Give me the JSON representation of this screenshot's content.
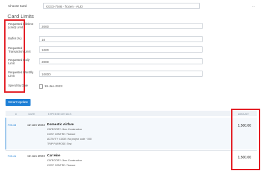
{
  "choose_card": {
    "label": "Choose Card",
    "value": "XXXX-7046 · frozen · AUD",
    "more": "..."
  },
  "card_limits": {
    "title": "Card Limits",
    "fields": [
      {
        "label": "Requested Lifetime (card) Limit",
        "value": "2000"
      },
      {
        "label": "Buffer (%)",
        "value": "10"
      },
      {
        "label": "Requested Transaction Limit",
        "value": "1000"
      },
      {
        "label": "Requested Daily Limit",
        "value": "2000"
      },
      {
        "label": "Requested Monthly Limit",
        "value": "10000"
      }
    ],
    "spend_by": {
      "label": "Spend By Date",
      "value": "19-Jan-2023"
    }
  },
  "smart_update": {
    "label": "Smart Update"
  },
  "table": {
    "headers": {
      "num": "#",
      "date": "DATE",
      "details": "EXPENSE DETAILS",
      "amount": "AMOUNT"
    },
    "rows": [
      {
        "id": "795.43",
        "date": "12-Jan-2023",
        "title": "Domestic Airfare",
        "meta": [
          "CATEGORY: Jims Construction",
          "COST CENTRE: Finance",
          "ACTIVITY CODE: No project code · 000",
          "TRIP PURPOSE: Test"
        ],
        "amount": "1,500.00"
      },
      {
        "id": "795.41",
        "date": "12-Jan-2023",
        "title": "Car Hire",
        "meta": [
          "CATEGORY: Jims Construction",
          "COST CENTRE: Finance"
        ],
        "amount": "1,500.00"
      }
    ]
  },
  "colors": {
    "accent": "#1d7fd6",
    "highlight": "#e31c23"
  }
}
